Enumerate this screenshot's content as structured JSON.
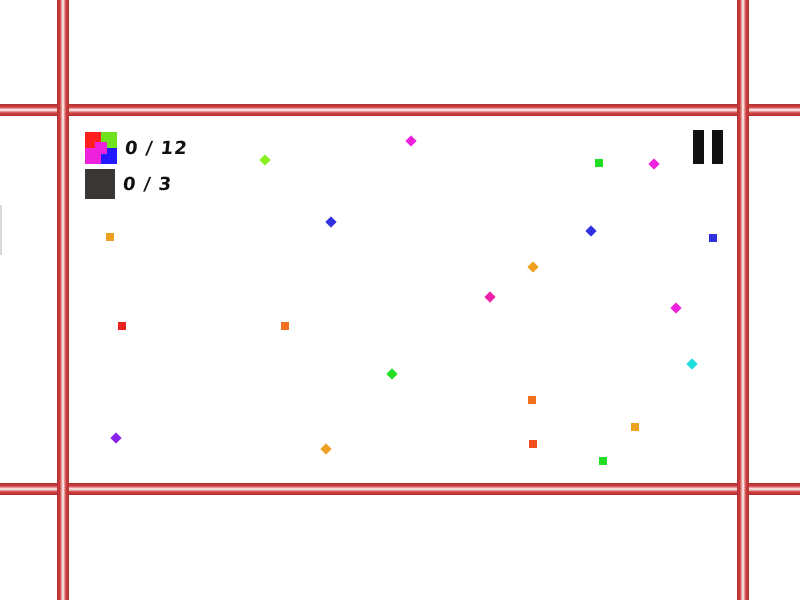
{
  "hud": {
    "gems_counter": "0 / 12",
    "blocks_counter": "0 / 3",
    "gems_icon": "colored-gems-icon",
    "blocks_icon": "dark-block-icon"
  },
  "pause": {
    "icon": "pause-icon"
  },
  "colors": {
    "grid_line": "#c93f3f",
    "background": "#ffffff",
    "hud_text": "#111111",
    "block": "#3a3735"
  },
  "gems": [
    {
      "color": "#ee22dd",
      "rotated": true
    },
    {
      "color": "#88ee22",
      "rotated": true
    },
    {
      "color": "#22dd22",
      "rotated": false
    },
    {
      "color": "#ee22dd",
      "rotated": true
    },
    {
      "color": "#f0a020",
      "rotated": false
    },
    {
      "color": "#3030e0",
      "rotated": true
    },
    {
      "color": "#3030e0",
      "rotated": true
    },
    {
      "color": "#3030e0",
      "rotated": false
    },
    {
      "color": "#f0a020",
      "rotated": true
    },
    {
      "color": "#ee22aa",
      "rotated": true
    },
    {
      "color": "#ee22dd",
      "rotated": true
    },
    {
      "color": "#e82020",
      "rotated": false
    },
    {
      "color": "#f07020",
      "rotated": false
    },
    {
      "color": "#22dd22",
      "rotated": true
    },
    {
      "color": "#22dddd",
      "rotated": true
    },
    {
      "color": "#f07020",
      "rotated": false
    },
    {
      "color": "#f0a020",
      "rotated": false
    },
    {
      "color": "#8822ee",
      "rotated": true
    },
    {
      "color": "#f0a020",
      "rotated": true
    },
    {
      "color": "#f05020",
      "rotated": false
    },
    {
      "color": "#22dd22",
      "rotated": false
    }
  ]
}
